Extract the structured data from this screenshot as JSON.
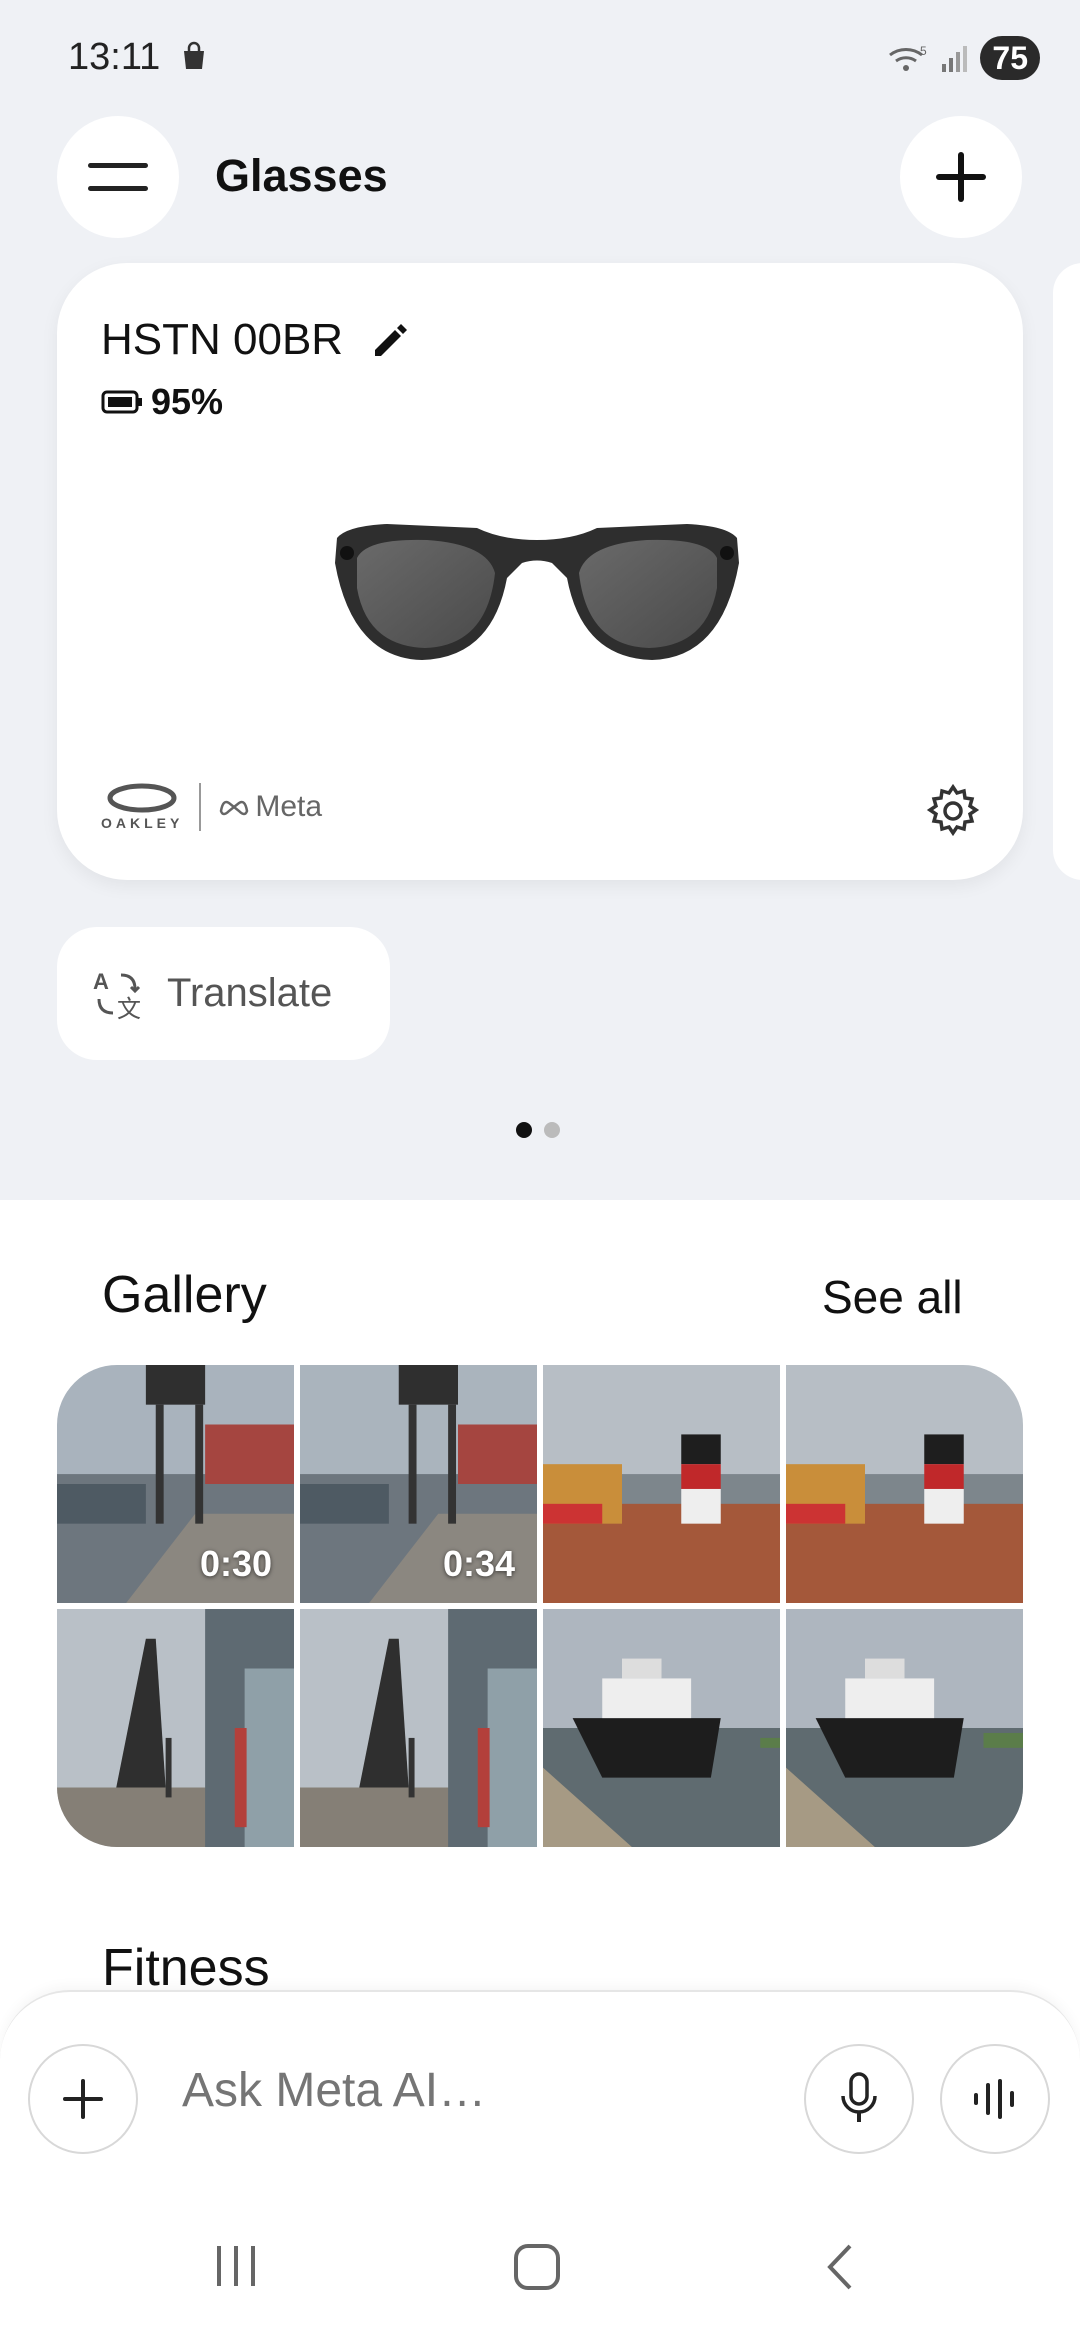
{
  "status_bar": {
    "time": "13:11",
    "battery": "75",
    "icons": [
      "shopping-bag-icon",
      "wifi-icon",
      "signal-icon"
    ]
  },
  "header": {
    "title": "Glasses",
    "menu_icon": "hamburger-icon",
    "add_icon": "plus-icon"
  },
  "device_card": {
    "name": "HSTN 00BR",
    "battery_percent": "95%",
    "brand_left": "OAKLEY",
    "brand_right": "Meta",
    "settings_icon": "gear-icon"
  },
  "translate_chip": {
    "label": "Translate",
    "icon": "translate-icon"
  },
  "carousel": {
    "pages": 2,
    "active_index": 0
  },
  "gallery": {
    "title": "Gallery",
    "see_all": "See all",
    "items": [
      {
        "type": "video",
        "duration": "0:30",
        "scene": "crane"
      },
      {
        "type": "video",
        "duration": "0:34",
        "scene": "crane"
      },
      {
        "type": "photo",
        "duration": "",
        "scene": "tugboat"
      },
      {
        "type": "photo",
        "duration": "",
        "scene": "tugboat"
      },
      {
        "type": "photo",
        "duration": "",
        "scene": "crane-street"
      },
      {
        "type": "photo",
        "duration": "",
        "scene": "crane-street"
      },
      {
        "type": "photo",
        "duration": "",
        "scene": "boat"
      },
      {
        "type": "photo",
        "duration": "",
        "scene": "boat"
      }
    ]
  },
  "fitness": {
    "title": "Fitness"
  },
  "ask_bar": {
    "placeholder": "Ask Meta AI…",
    "icons": [
      "plus-icon",
      "microphone-icon",
      "voice-waveform-icon"
    ]
  },
  "nav_bar": {
    "icons": [
      "recent-apps-icon",
      "home-icon",
      "back-icon"
    ]
  }
}
